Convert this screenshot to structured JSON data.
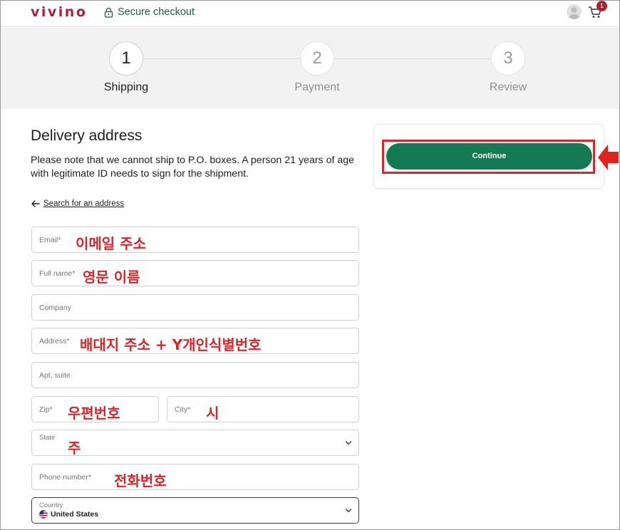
{
  "header": {
    "logo": "vivino",
    "secure_label": "Secure checkout",
    "cart_count": "1"
  },
  "steps": [
    {
      "number": "1",
      "label": "Shipping",
      "active": true
    },
    {
      "number": "2",
      "label": "Payment",
      "active": false
    },
    {
      "number": "3",
      "label": "Review",
      "active": false
    }
  ],
  "form": {
    "title": "Delivery address",
    "note": "Please note that we cannot ship to P.O. boxes. A person 21 years of age with legitimate ID needs to sign for the shipment.",
    "search_link": "Search for an address",
    "fields": {
      "email": {
        "label": "Email*",
        "annotation": "이메일 주소"
      },
      "fullname": {
        "label": "Full name*",
        "annotation": "영문 이름"
      },
      "company": {
        "label": "Company"
      },
      "address": {
        "label": "Address*",
        "annotation": "배대지 주소 + Y개인식별번호"
      },
      "apt": {
        "label": "Apt, suite"
      },
      "zip": {
        "label": "Zip*",
        "annotation": "우편번호"
      },
      "city": {
        "label": "City*",
        "annotation": "시"
      },
      "state": {
        "label": "State",
        "annotation": "주"
      },
      "phone": {
        "label": "Phone number*",
        "annotation": "전화번호"
      },
      "country": {
        "label": "Country",
        "value": "United States"
      }
    }
  },
  "panel": {
    "continue_label": "Continue"
  },
  "colors": {
    "brand": "#a8243a",
    "continue": "#137a55",
    "annotation_red": "#d6262a"
  }
}
